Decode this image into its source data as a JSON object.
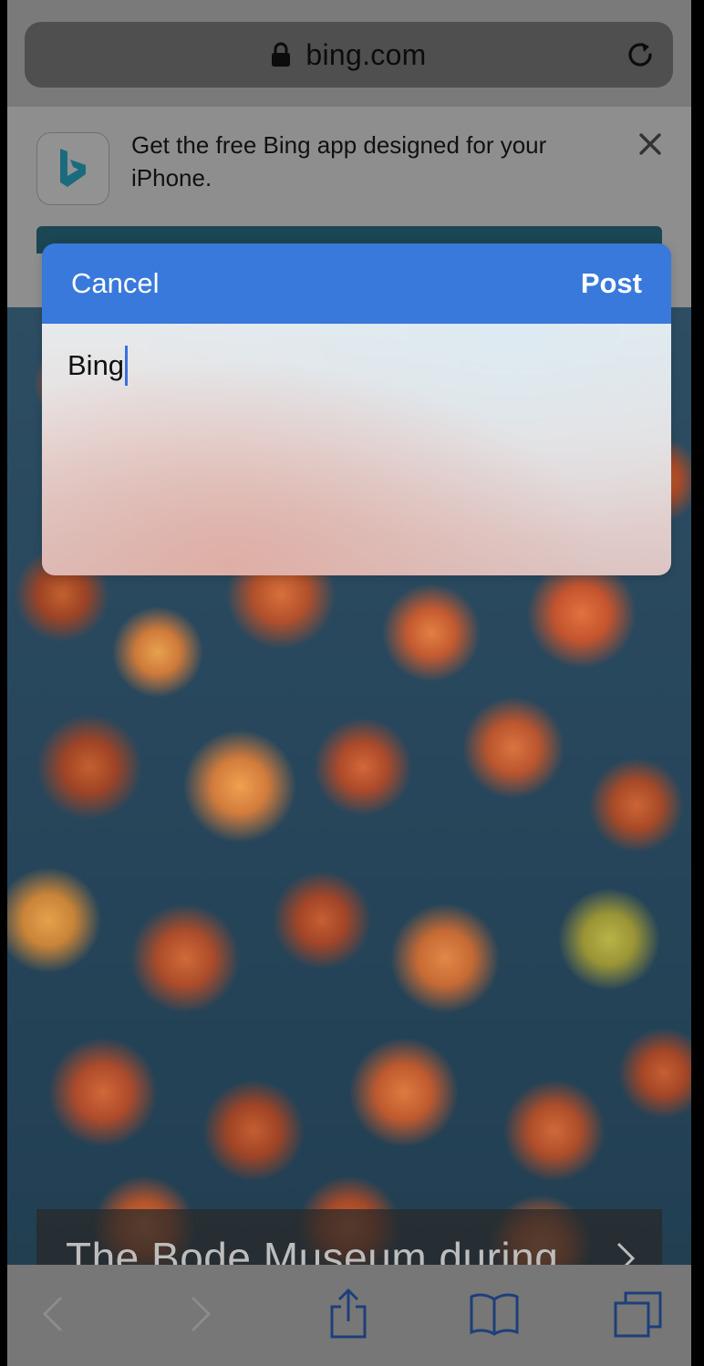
{
  "browser": {
    "url": "bing.com",
    "icons": {
      "lock": "lock-icon",
      "reload": "reload-icon"
    }
  },
  "banner": {
    "text": "Get the free Bing app designed for your iPhone.",
    "close_icon": "close-icon",
    "app_icon": "bing-logo-icon",
    "brand_color": "#1b6b7f"
  },
  "dialog": {
    "cancel_label": "Cancel",
    "post_label": "Post",
    "text_value": "Bing",
    "header_color": "#3879db"
  },
  "caption": {
    "text": "The Bode Museum during",
    "chevron_icon": "chevron-right-icon"
  },
  "toolbar": {
    "items": [
      "back-icon",
      "forward-icon",
      "share-icon",
      "bookmarks-icon",
      "tabs-icon"
    ]
  }
}
